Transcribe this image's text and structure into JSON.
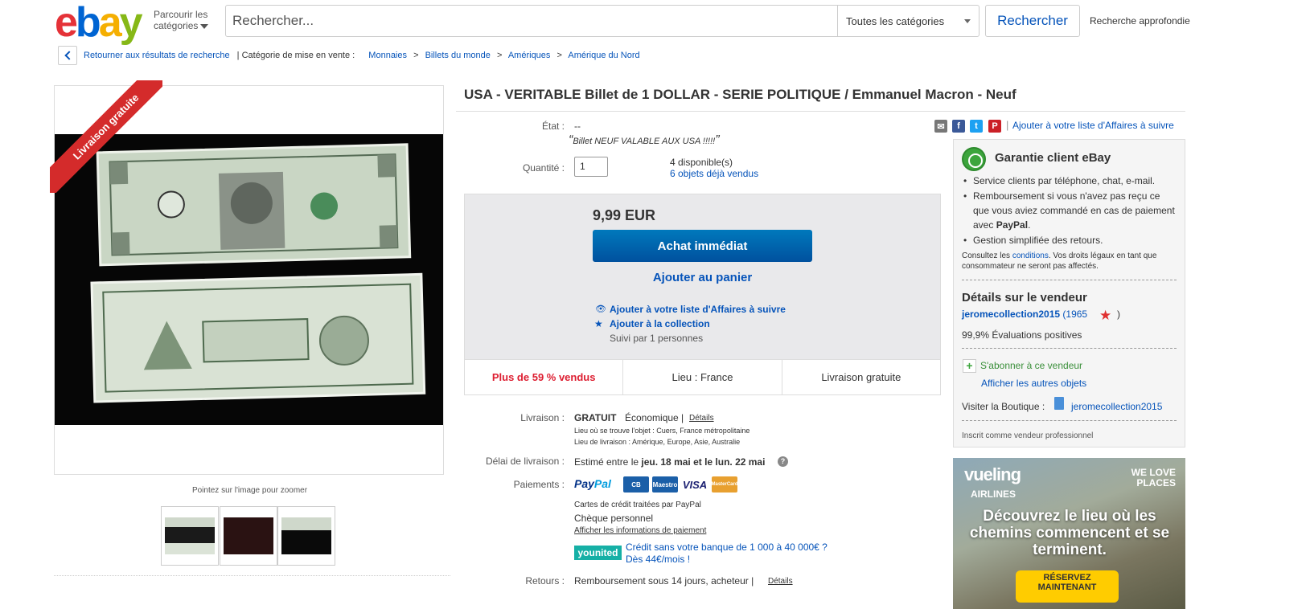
{
  "header": {
    "logo_text": "ebay",
    "browse_line1": "Parcourir les",
    "browse_line2": "catégories",
    "search_placeholder": "Rechercher...",
    "category_select": "Toutes les catégories",
    "search_button": "Rechercher",
    "advanced_search": "Recherche approfondie"
  },
  "breadcrumb": {
    "back": "Retourner aux résultats de recherche",
    "category_label": "| Catégorie de mise en vente :",
    "items": [
      "Monnaies",
      "Billets du monde",
      "Amériques",
      "Amérique du Nord"
    ],
    "sep": ">"
  },
  "gallery": {
    "ribbon": "Livraison gratuite",
    "zoom_hint": "Pointez sur l'image pour zoomer"
  },
  "item": {
    "title": "USA - VERITABLE Billet de 1 DOLLAR - SERIE POLITIQUE / Emmanuel Macron - Neuf",
    "condition_label": "État :",
    "condition_value": "--",
    "condition_quote": "Billet NEUF VALABLE AUX USA !!!!!",
    "quantity_label": "Quantité :",
    "quantity_value": "1",
    "available": "4 disponible(s)",
    "sold": "6 objets déjà vendus"
  },
  "buybox": {
    "price": "9,99 EUR",
    "buy_now": "Achat immédiat",
    "add_to_cart": "Ajouter au panier",
    "watch": "Ajouter à votre liste d'Affaires à suivre",
    "collection": "Ajouter à la collection",
    "followers": "Suivi par 1 personnes",
    "stats": [
      "Plus de 59 % vendus",
      "Lieu : France",
      "Livraison gratuite"
    ]
  },
  "shipping": {
    "label": "Livraison :",
    "free": "GRATUIT",
    "type": "Économique |",
    "details": "Détails",
    "location": "Lieu où se trouve l'objet :  Cuers, France métropolitaine",
    "ships_to": "Lieu de livraison :  Amérique, Europe, Asie, Australie",
    "delay_label": "Délai de livraison :",
    "delay_prefix": "Estimé entre le ",
    "delay_dates": "jeu. 18 mai et le lun. 22 mai"
  },
  "payments": {
    "label": "Paiements :",
    "paypal": "PayPal",
    "cards": [
      "CB",
      "Maestro",
      "VISA",
      "MasterCard"
    ],
    "card_colors": [
      "#1b5fa8",
      "#1b5fa8",
      "#1a1f71",
      "#e8a030"
    ],
    "cards_note": "Cartes de crédit traitées par PayPal",
    "cheque": "Chèque personnel",
    "info_link": "Afficher les informations de paiement",
    "younited": "younited",
    "credit_line1": "Crédit sans votre banque de 1 000 à 40 000€ ?",
    "credit_line2": "Dès 44€/mois !"
  },
  "returns": {
    "label": "Retours :",
    "value": "Remboursement sous 14 jours, acheteur |",
    "details": "Détails"
  },
  "share": {
    "icons": [
      "email-icon",
      "facebook-icon",
      "twitter-icon",
      "pinterest-icon"
    ],
    "icon_glyphs": [
      "✉",
      "f",
      "t",
      "P"
    ],
    "icon_colors": [
      "#777777",
      "#3b5998",
      "#1da1f2",
      "#cb2027"
    ],
    "watch_link": "Ajouter à votre liste d'Affaires à suivre"
  },
  "guarantee": {
    "title": "Garantie client eBay",
    "bullets": [
      "Service clients par téléphone, chat, e-mail.",
      "Remboursement si vous n'avez pas reçu ce que vous aviez commandé en cas de paiement avec",
      "Gestion simplifiée des retours."
    ],
    "paypal_word": "PayPal",
    "note_prefix": "Consultez les ",
    "note_link": "conditions",
    "note_suffix": ". Vos droits légaux en tant que consommateur ne seront pas affectés."
  },
  "seller": {
    "heading": "Détails sur le vendeur",
    "name": "jeromecollection2015",
    "score": "(1965",
    "close": ")",
    "positive": "99,9% Évaluations positives",
    "subscribe": "S'abonner à ce vendeur",
    "other_items": "Afficher les autres objets",
    "shop_label": "Visiter la Boutique :",
    "shop_name": "jeromecollection2015",
    "pro": "Inscrit comme vendeur professionnel"
  },
  "ad": {
    "brand": "vueling",
    "sub": "AIRLINES",
    "tagline": "WE LOVE PLACES",
    "headline": "Découvrez le lieu où les chemins commencent et se terminent.",
    "cta": "RÉSERVEZ MAINTENANT"
  }
}
